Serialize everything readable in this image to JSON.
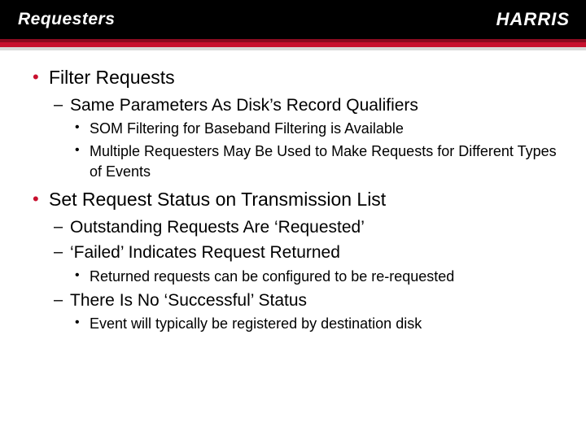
{
  "header": {
    "title": "Requesters",
    "logo": "HARRIS"
  },
  "bullets": [
    {
      "text": "Filter Requests",
      "sub": [
        {
          "text": "Same Parameters As Disk’s Record Qualifiers",
          "sub": [
            {
              "text": "SOM Filtering for Baseband Filtering is Available"
            },
            {
              "text": "Multiple Requesters May Be Used to Make Requests for Different Types of Events"
            }
          ]
        }
      ]
    },
    {
      "text": "Set Request Status on Transmission List",
      "sub": [
        {
          "text": "Outstanding Requests Are ‘Requested’"
        },
        {
          "text": "‘Failed’ Indicates Request Returned",
          "sub": [
            {
              "text": "Returned requests can be configured to be re-requested"
            }
          ]
        },
        {
          "text": "There Is No ‘Successful’ Status",
          "sub": [
            {
              "text": "Event will typically be registered by destination disk"
            }
          ]
        }
      ]
    }
  ]
}
